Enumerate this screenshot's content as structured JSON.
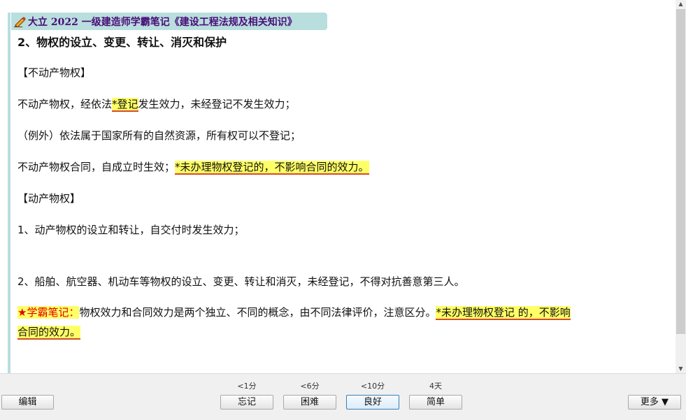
{
  "header": {
    "title": "大立 2022 一级建造师学霸笔记《建设工程法规及相关知识》"
  },
  "content": {
    "heading": "2、物权的设立、变更、转让、消灭和保护",
    "immovable_label": "【不动产物权】",
    "immovable_rule": {
      "before": "不动产物权，经依法",
      "highlight": "*登记",
      "after": "发生效力，未经登记不发生效力；"
    },
    "exception": "（例外）依法属于国家所有的自然资源，所有权可以不登记；",
    "contract_rule": {
      "before": "不动产物权合同，自成立时生效；",
      "highlight": "*未办理物权登记的，不影响合同的效力。"
    },
    "movable_label": "【动产物权】",
    "movable_item1": "1、动产物权的设立和转让，自交付时发生效力；",
    "movable_item2": "2、船舶、航空器、机动车等物权的设立、变更、转让和消灭，未经登记，不得对抗善意第三人。",
    "note": {
      "label": "★学霸笔记：",
      "text": "物权效力和合同效力是两个独立、不同的概念，由不同法律评价，注意区分。",
      "highlight_line1": "*未办理物权登记  的，不影响",
      "highlight_line2": "合同的效力。"
    }
  },
  "footer": {
    "edit_label": "编辑",
    "more_label": "更多 ▼",
    "answers": [
      {
        "interval": "<1分",
        "label": "忘记"
      },
      {
        "interval": "<6分",
        "label": "困难"
      },
      {
        "interval": "<10分",
        "label": "良好"
      },
      {
        "interval": "4天",
        "label": "简单"
      }
    ]
  },
  "colors": {
    "banner_bg": "#b9dede",
    "title_text": "#4a0d78",
    "highlight_bg": "#ffff66",
    "highlight_underline": "#d44a28",
    "note_label": "#e00000"
  }
}
